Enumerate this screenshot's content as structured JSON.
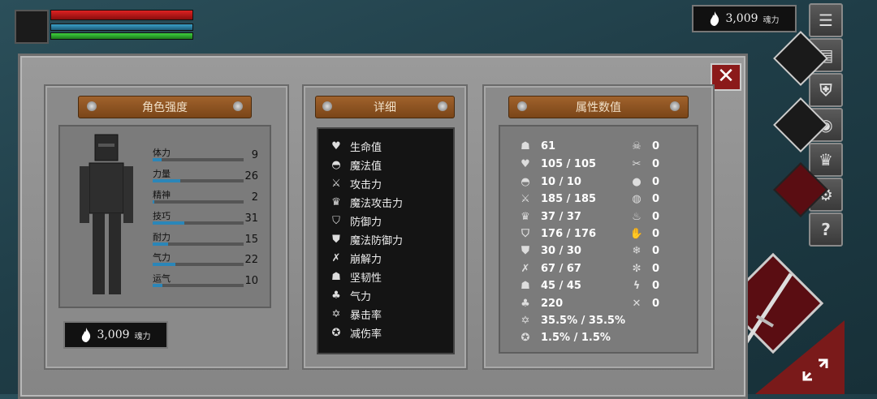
{
  "hud": {
    "currency_value": "3,009",
    "currency_unit": "魂力"
  },
  "panels": {
    "strength_title": "角色强度",
    "detail_title": "详细",
    "attr_title": "属性数值"
  },
  "stats": [
    {
      "label": "体力",
      "value": "9",
      "fill": 0.1
    },
    {
      "label": "力量",
      "value": "26",
      "fill": 0.3
    },
    {
      "label": "精神",
      "value": "2",
      "fill": 0.02
    },
    {
      "label": "技巧",
      "value": "31",
      "fill": 0.35
    },
    {
      "label": "耐力",
      "value": "15",
      "fill": 0.17
    },
    {
      "label": "气力",
      "value": "22",
      "fill": 0.25
    },
    {
      "label": "运气",
      "value": "10",
      "fill": 0.11
    }
  ],
  "details": [
    {
      "label": "生命值",
      "icon": "heart-icon"
    },
    {
      "label": "魔法值",
      "icon": "brain-icon"
    },
    {
      "label": "攻击力",
      "icon": "sword-icon"
    },
    {
      "label": "魔法攻击力",
      "icon": "crown-icon"
    },
    {
      "label": "防御力",
      "icon": "shield-icon"
    },
    {
      "label": "魔法防御力",
      "icon": "magic-shield-icon"
    },
    {
      "label": "崩解力",
      "icon": "break-icon"
    },
    {
      "label": "坚韧性",
      "icon": "helmet-icon"
    },
    {
      "label": "气力",
      "icon": "lungs-icon"
    },
    {
      "label": "暴击率",
      "icon": "crit-icon"
    },
    {
      "label": "减伤率",
      "icon": "badge-icon"
    }
  ],
  "attr_left": [
    {
      "value": "61",
      "icon": "level-icon"
    },
    {
      "value": "105 / 105",
      "icon": "heart-icon"
    },
    {
      "value": "10 / 10",
      "icon": "brain-icon"
    },
    {
      "value": "185 / 185",
      "icon": "sword-icon"
    },
    {
      "value": "37 / 37",
      "icon": "crown-icon"
    },
    {
      "value": "176 / 176",
      "icon": "shield-icon"
    },
    {
      "value": "30 / 30",
      "icon": "magic-shield-icon"
    },
    {
      "value": "67 / 67",
      "icon": "break-icon"
    },
    {
      "value": "45 / 45",
      "icon": "helmet-icon"
    },
    {
      "value": "220",
      "icon": "lungs-icon"
    },
    {
      "value": "35.5% / 35.5%",
      "icon": "crit-icon"
    },
    {
      "value": "1.5% / 1.5%",
      "icon": "badge-icon"
    }
  ],
  "attr_right": [
    {
      "value": "0",
      "icon": "skull-icon"
    },
    {
      "value": "0",
      "icon": "bones-icon"
    },
    {
      "value": "0",
      "icon": "blood-icon"
    },
    {
      "value": "0",
      "icon": "poison-icon"
    },
    {
      "value": "0",
      "icon": "fire-icon"
    },
    {
      "value": "0",
      "icon": "hand-icon"
    },
    {
      "value": "0",
      "icon": "frost-icon"
    },
    {
      "value": "0",
      "icon": "frost2-icon"
    },
    {
      "value": "0",
      "icon": "lightning-icon"
    },
    {
      "value": "0",
      "icon": "needle-icon"
    }
  ],
  "side_menu": [
    "menu-icon",
    "journal-icon",
    "armor-icon",
    "emblem-icon",
    "crown-icon",
    "gear-icon",
    "help-icon"
  ],
  "side_glyphs": {
    "menu": "☰",
    "journal": "▤",
    "armor": "⛨",
    "emblem": "◉",
    "crown": "♛",
    "gear": "⚙",
    "help": "?"
  },
  "colors": {
    "hp": "#c81a1a",
    "mp": "#2f8db3",
    "stamina": "#2fae2f",
    "close": "#8b1a1a",
    "plank": "#8f5322"
  }
}
